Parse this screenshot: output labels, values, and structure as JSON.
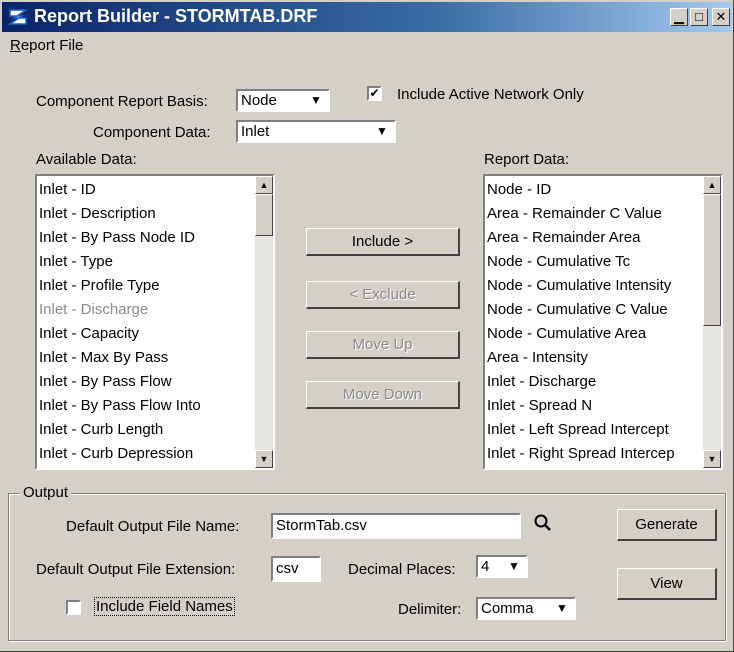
{
  "window": {
    "title": "Report Builder - STORMTAB.DRF",
    "minimize_glyph": "▁",
    "maximize_glyph": "□",
    "close_glyph": "✕"
  },
  "menu": {
    "report_file": "Report File"
  },
  "component": {
    "basis_label": "Component Report Basis:",
    "basis_value": "Node",
    "include_active_label": "Include Active Network Only",
    "include_active_checked": true,
    "data_label": "Component Data:",
    "data_value": "Inlet"
  },
  "available": {
    "label": "Available Data:",
    "items": [
      {
        "text": "Inlet - ID",
        "disabled": false
      },
      {
        "text": "Inlet - Description",
        "disabled": false
      },
      {
        "text": "Inlet - By Pass Node ID",
        "disabled": false
      },
      {
        "text": "Inlet - Type",
        "disabled": false
      },
      {
        "text": "Inlet - Profile Type",
        "disabled": false
      },
      {
        "text": "Inlet - Discharge",
        "disabled": true
      },
      {
        "text": "Inlet - Capacity",
        "disabled": false
      },
      {
        "text": "Inlet - Max By Pass",
        "disabled": false
      },
      {
        "text": "Inlet - By Pass Flow",
        "disabled": false
      },
      {
        "text": "Inlet - By Pass Flow Into",
        "disabled": false
      },
      {
        "text": "Inlet - Curb Length",
        "disabled": false
      },
      {
        "text": "Inlet - Curb Depression",
        "disabled": false
      }
    ]
  },
  "report": {
    "label": "Report Data:",
    "items": [
      "Node - ID",
      "Area - Remainder C Value",
      "Area - Remainder Area",
      "Node - Cumulative Tc",
      "Node - Cumulative Intensity",
      "Node - Cumulative C Value",
      "Node - Cumulative Area",
      "Area - Intensity",
      "Inlet - Discharge",
      "Inlet - Spread N",
      "Inlet - Left Spread Intercept",
      "Inlet - Right Spread Intercep"
    ]
  },
  "actions": {
    "include": "Include >",
    "exclude": "< Exclude",
    "move_up": "Move Up",
    "move_down": "Move Down"
  },
  "output": {
    "group_label": "Output",
    "file_name_label": "Default Output File Name:",
    "file_name_value": "StormTab.csv",
    "extension_label": "Default Output File Extension:",
    "extension_value": "csv",
    "decimal_label": "Decimal Places:",
    "decimal_value": "4",
    "include_field_names_label": "Include Field Names",
    "include_field_names_checked": false,
    "delimiter_label": "Delimiter:",
    "delimiter_value": "Comma",
    "generate": "Generate",
    "view": "View"
  },
  "colors": {
    "title_gradient_start": "#0a246a",
    "title_gradient_end": "#a6caf0",
    "face": "#d4d0c8",
    "disabled_text": "#8a8a8a"
  }
}
